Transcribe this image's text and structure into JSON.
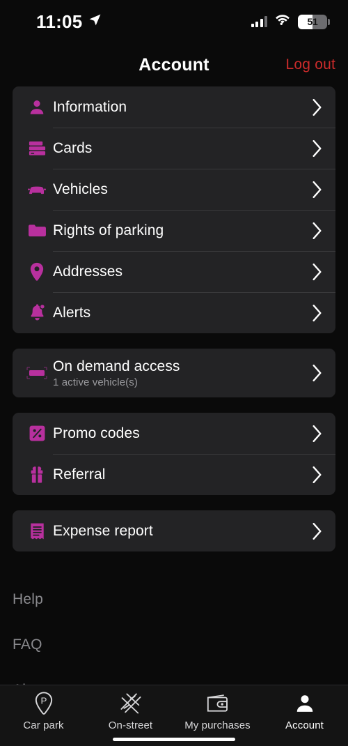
{
  "theme": {
    "accent": "#b8309e",
    "danger": "#cc2b2b",
    "page_bg": "#0a0a0a",
    "card_bg": "#232325",
    "text": "#ffffff",
    "muted": "#8a8a8e"
  },
  "status_bar": {
    "time": "11:05",
    "location_icon": "location-arrow-icon",
    "signal_icon": "cellular-signal-icon",
    "wifi_icon": "wifi-icon",
    "battery_level": "51",
    "battery_percent": 51
  },
  "header": {
    "title": "Account",
    "logout_label": "Log out"
  },
  "account_section": {
    "items": [
      {
        "label": "Information",
        "icon": "person-icon"
      },
      {
        "label": "Cards",
        "icon": "credit-cards-icon"
      },
      {
        "label": "Vehicles",
        "icon": "car-icon"
      },
      {
        "label": "Rights of parking",
        "icon": "folder-icon"
      },
      {
        "label": "Addresses",
        "icon": "map-pin-icon"
      },
      {
        "label": "Alerts",
        "icon": "bell-icon"
      }
    ]
  },
  "on_demand_section": {
    "items": [
      {
        "label": "On demand access",
        "sublabel": "1 active vehicle(s)",
        "icon": "license-plate-icon"
      }
    ]
  },
  "promo_section": {
    "items": [
      {
        "label": "Promo codes",
        "icon": "percent-tag-icon"
      },
      {
        "label": "Referral",
        "icon": "gift-icon"
      }
    ]
  },
  "expense_section": {
    "items": [
      {
        "label": "Expense report",
        "icon": "receipt-icon"
      }
    ]
  },
  "footer_links": [
    {
      "label": "Help"
    },
    {
      "label": "FAQ"
    },
    {
      "label": "About"
    }
  ],
  "tab_bar": {
    "tabs": [
      {
        "label": "Car park",
        "icon": "parking-pin-icon",
        "active": false
      },
      {
        "label": "On-street",
        "icon": "street-cross-icon",
        "active": false
      },
      {
        "label": "My purchases",
        "icon": "wallet-icon",
        "active": false
      },
      {
        "label": "Account",
        "icon": "person-filled-icon",
        "active": true
      }
    ]
  }
}
